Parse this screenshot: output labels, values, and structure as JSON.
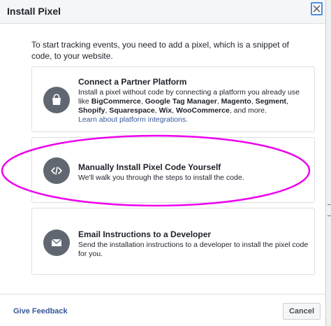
{
  "dialog": {
    "title": "Install Pixel",
    "intro": "To start tracking events, you need to add a pixel, which is a snippet of code, to your website."
  },
  "options": [
    {
      "title": "Connect a Partner Platform",
      "icon": "shopping-bag-icon",
      "desc_start": "Install a pixel without code by connecting a platform you already use like ",
      "platforms": [
        "BigCommerce",
        "Google Tag Manager",
        "Magento",
        "Segment",
        "Shopify",
        "Squarespace",
        "Wix",
        "WooCommerce"
      ],
      "sep": ", ",
      "desc_and": " and more.",
      "link": "Learn about platform integrations."
    },
    {
      "title": "Manually Install Pixel Code Yourself",
      "icon": "code-icon",
      "desc": "We'll walk you through the steps to install the code."
    },
    {
      "title": "Email Instructions to a Developer",
      "icon": "envelope-icon",
      "desc": "Send the installation instructions to a developer to install the pixel code for you."
    }
  ],
  "footer": {
    "feedback": "Give Feedback",
    "cancel": "Cancel"
  },
  "colors": {
    "link": "#385898",
    "icon_bg": "#606770",
    "highlight": "#ee00ee",
    "close_focus": "#4a8ee8"
  }
}
